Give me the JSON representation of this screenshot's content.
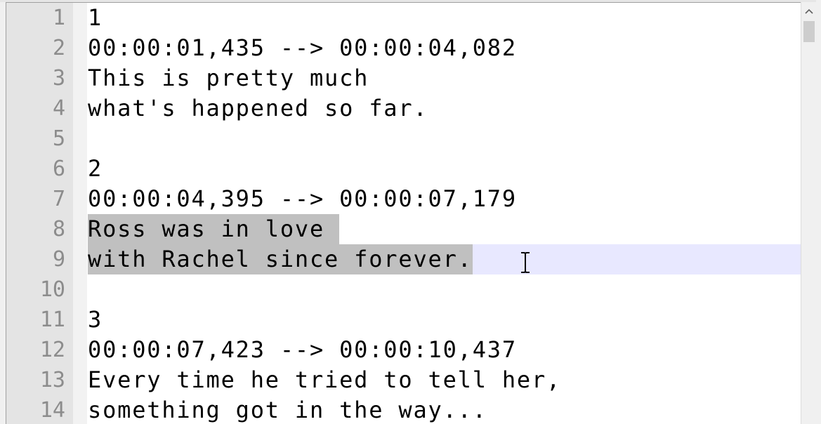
{
  "editor": {
    "lines": [
      {
        "number": "1",
        "text": "1"
      },
      {
        "number": "2",
        "text": "00:00:01,435 --> 00:00:04,082"
      },
      {
        "number": "3",
        "text": "This is pretty much"
      },
      {
        "number": "4",
        "text": "what's happened so far."
      },
      {
        "number": "5",
        "text": ""
      },
      {
        "number": "6",
        "text": "2"
      },
      {
        "number": "7",
        "text": "00:00:04,395 --> 00:00:07,179"
      },
      {
        "number": "8",
        "text": "Ross was in love "
      },
      {
        "number": "9",
        "text": "with Rachel since forever."
      },
      {
        "number": "10",
        "text": ""
      },
      {
        "number": "11",
        "text": "3"
      },
      {
        "number": "12",
        "text": "00:00:07,423 --> 00:00:10,437"
      },
      {
        "number": "13",
        "text": "Every time he tried to tell her,"
      },
      {
        "number": "14",
        "text": "something got in the way..."
      }
    ],
    "selected_lines": [
      "8",
      "9"
    ],
    "caret_line": "9",
    "cursor_icon": "text-ibeam-cursor-icon"
  },
  "scrollbar": {
    "up_arrow_icon": "chevron-up-icon"
  },
  "colors": {
    "gutter": "#e4e4e4",
    "line_number": "#8c8c8c",
    "selection": "#c0c0c0",
    "caret_line": "#e8e8ff",
    "text": "#000000"
  }
}
